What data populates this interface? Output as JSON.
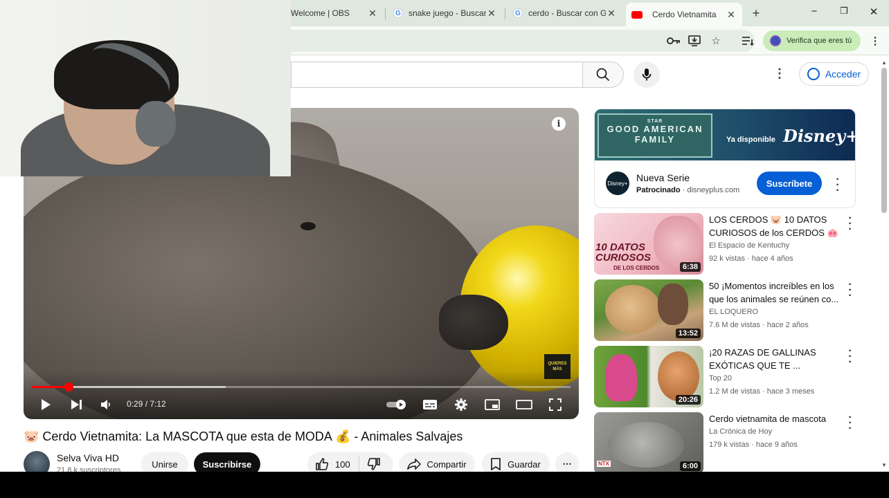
{
  "browser": {
    "tabs": [
      {
        "title": "Welcome | OBS",
        "favicon": "obs-icon"
      },
      {
        "title": "snake juego - Buscar",
        "favicon": "google-icon"
      },
      {
        "title": "cerdo - Buscar con G",
        "favicon": "google-icon"
      },
      {
        "title": "Cerdo Vietnamita",
        "favicon": "youtube-icon",
        "active": true
      }
    ],
    "new_tab": "+",
    "window_controls": {
      "minimize": "−",
      "maximize": "❐",
      "close": "✕"
    },
    "verify_label": "Verifica que eres tú"
  },
  "youtube": {
    "sign_in_label": "Acceder",
    "player": {
      "current_time": "0:29 / 7:12",
      "progress_fraction": 0.0676,
      "buffer_fraction": 0.36,
      "corner_badge": "QUIERES MÁS",
      "info": "i"
    },
    "video": {
      "title": "🐷 Cerdo Vietnamita: La MASCOTA que esta de MODA 💰 - Animales Salvajes",
      "channel": "Selva Viva HD",
      "subscribers": "21,8 k suscriptores",
      "join_label": "Unirse",
      "subscribe_label": "Suscribirse",
      "likes": "100",
      "share_label": "Compartir",
      "save_label": "Guardar"
    },
    "ad": {
      "banner_small": "STAR",
      "banner_title": "GOOD AMERICAN FAMILY",
      "banner_available": "Ya disponible",
      "banner_brand": "Disney+",
      "logo_text": "Disney+",
      "title": "Nueva Serie",
      "sponsored": "Patrocinado",
      "domain": "· disneyplus.com",
      "subscribe_label": "Suscríbete"
    },
    "recommendations": [
      {
        "title": "LOS CERDOS 🐷 10 DATOS CURIOSOS de los CERDOS 🐽 ...",
        "channel": "El Espacio de Kentuchy",
        "meta": "92 k vistas · hace 4 años",
        "duration": "6:38",
        "thumb_text": "10 DATOS CURIOSOS",
        "thumb_sub": "DE LOS CERDOS"
      },
      {
        "title": "50 ¡Momentos increíbles en los que los animales se reúnen co...",
        "channel": "EL LOQUERO",
        "meta": "7.6 M de vistas · hace 2 años",
        "duration": "13:52"
      },
      {
        "title": "¡20 RAZAS DE GALLINAS EXÓTICAS QUE TE ...",
        "channel": "Top 20",
        "meta": "1.2 M de vistas · hace 3 meses",
        "duration": "20:26"
      },
      {
        "title": "Cerdo vietnamita de mascota",
        "channel": "La Crónica de Hoy",
        "meta": "179 k vistas · hace 9 años",
        "duration": "6:00",
        "thumb_text": "NTX"
      }
    ]
  }
}
